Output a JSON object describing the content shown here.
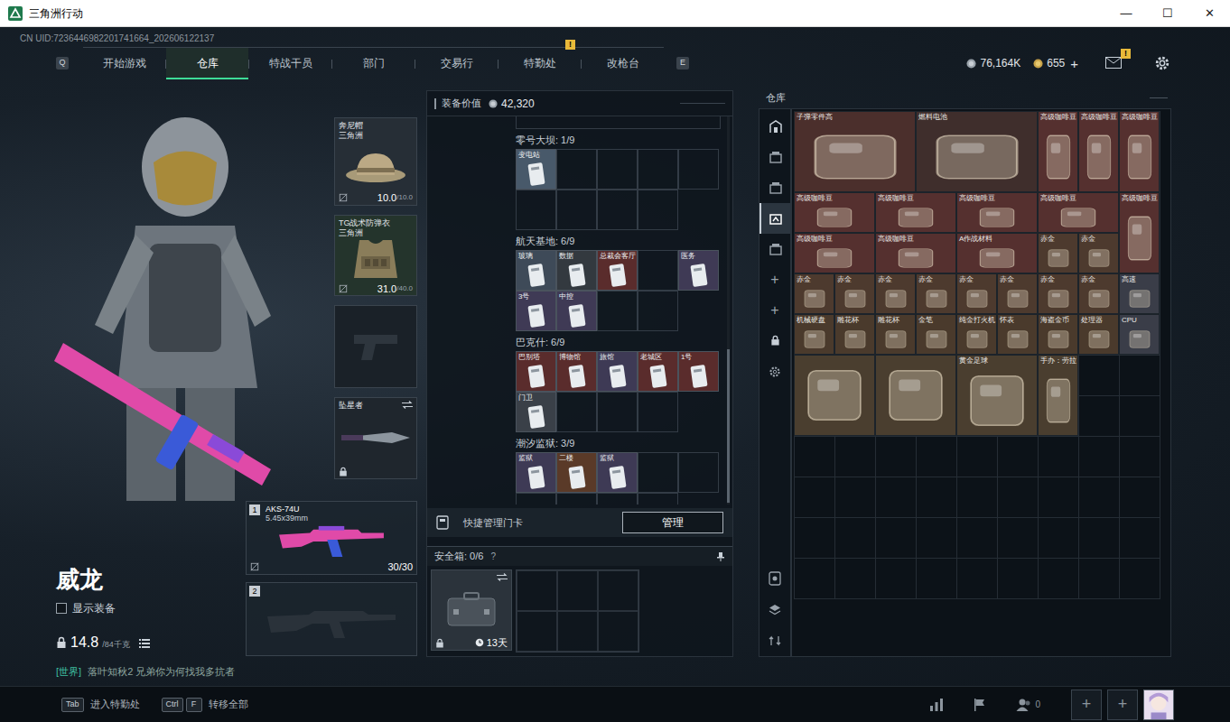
{
  "window": {
    "title": "三角洲行动",
    "controls": [
      "—",
      "☐",
      "✕"
    ]
  },
  "uid": "CN UID:7236446982201741664_202606122137",
  "nav": {
    "prev_key": "Q",
    "next_key": "E",
    "tabs": [
      {
        "label": "开始游戏",
        "selected": false
      },
      {
        "label": "仓库",
        "selected": true
      },
      {
        "label": "特战干员",
        "selected": false
      },
      {
        "label": "部门",
        "selected": false
      },
      {
        "label": "交易行",
        "selected": false
      },
      {
        "label": "特勤处",
        "selected": false,
        "badge": "!"
      },
      {
        "label": "改枪台",
        "selected": false
      }
    ]
  },
  "currency": {
    "coins": "76,164K",
    "tickets": "655",
    "add": "+",
    "mail_badge": "!"
  },
  "character": {
    "name": "威龙",
    "show_gear": {
      "label": "显示装备",
      "checked": false
    },
    "weight": "14.8",
    "weight_max": "/84千克",
    "chat_channel": "[世界]",
    "chat_message": "落叶知秋2 兄弟你为何找我多抗者"
  },
  "gear": [
    {
      "kind": "helmet",
      "name": "奔尼帽",
      "sub": "三角洲",
      "durability": "10.0",
      "max": "/10.0",
      "color": "#262e36"
    },
    {
      "kind": "armor",
      "name": "TG战术防弹衣",
      "sub": "三角洲",
      "durability": "31.0",
      "max": "/40.0",
      "color": "#24342c"
    },
    {
      "kind": "pistol",
      "color": "#1a2128"
    },
    {
      "kind": "melee",
      "name": "坠星者",
      "color": "#1f262d"
    }
  ],
  "weapons": [
    {
      "slot": "1",
      "kind": "rifle",
      "name": "AKS-74U",
      "caliber": "5.45x39mm",
      "ammo": "30/30"
    },
    {
      "slot": "2",
      "kind": "empty"
    }
  ],
  "loadout": {
    "value_label": "装备价值",
    "value": "42,320",
    "sections": [
      {
        "title": "零号大坝: 1/9",
        "slots": [
          {
            "kind": "card",
            "label": "变电站",
            "color": "#48596a"
          },
          {
            "kind": "empty"
          },
          {
            "kind": "empty"
          },
          {
            "kind": "empty"
          },
          {
            "kind": "empty"
          },
          {
            "kind": "empty"
          },
          {
            "kind": "empty"
          },
          {
            "kind": "empty"
          },
          {
            "kind": "empty"
          }
        ]
      },
      {
        "title": "航天基地: 6/9",
        "slots": [
          {
            "kind": "card",
            "label": "玻璃",
            "color": "#3e4a58"
          },
          {
            "kind": "card",
            "label": "数据",
            "color": "#33393f"
          },
          {
            "kind": "card",
            "label": "总裁会客厅",
            "color": "#5a2c2c"
          },
          {
            "kind": "empty"
          },
          {
            "kind": "card",
            "label": "医务",
            "color": "#3f3a55"
          },
          {
            "kind": "card",
            "label": "3号",
            "color": "#3f3a55"
          },
          {
            "kind": "card",
            "label": "中控",
            "color": "#3f3a55"
          },
          {
            "kind": "empty"
          },
          {
            "kind": "empty"
          }
        ]
      },
      {
        "title": "巴克什: 6/9",
        "slots": [
          {
            "kind": "card",
            "label": "巴别塔",
            "color": "#5a2c2c"
          },
          {
            "kind": "card",
            "label": "博物馆",
            "color": "#5a2c2c"
          },
          {
            "kind": "card",
            "label": "旅馆",
            "color": "#3e3a55"
          },
          {
            "kind": "card",
            "label": "老城区",
            "color": "#5a2c2c"
          },
          {
            "kind": "card",
            "label": "1号",
            "color": "#5a2c2c"
          },
          {
            "kind": "card",
            "label": "门卫",
            "color": "#3a4048"
          },
          {
            "kind": "empty"
          },
          {
            "kind": "empty"
          },
          {
            "kind": "empty"
          }
        ]
      },
      {
        "title": "潮汐监狱: 3/9",
        "slots": [
          {
            "kind": "card",
            "label": "监狱",
            "color": "#3e3a55"
          },
          {
            "kind": "card",
            "label": "二楼",
            "color": "#5a3a28"
          },
          {
            "kind": "card",
            "label": "监狱",
            "color": "#3e3a55"
          },
          {
            "kind": "empty"
          },
          {
            "kind": "empty"
          },
          {
            "kind": "empty"
          },
          {
            "kind": "empty"
          },
          {
            "kind": "empty"
          },
          {
            "kind": "empty"
          }
        ]
      }
    ],
    "quick_manage": {
      "label": "快捷管理门卡",
      "button": "管理"
    },
    "safe_box": {
      "title": "安全箱: 0/6",
      "help": "?",
      "duration": "13天"
    }
  },
  "warehouse": {
    "title": "仓库",
    "tabs": [
      {
        "selected": false
      },
      {
        "selected": false
      },
      {
        "selected": false
      },
      {
        "selected": true
      },
      {
        "selected": false
      }
    ],
    "actions": [
      "+",
      "+"
    ],
    "items": [
      {
        "kind": "block",
        "label": "子弹零件高",
        "color": "#4b2f2c"
      },
      {
        "kind": "block",
        "label": "燃料电池",
        "color": "#3f2e2c"
      },
      {
        "kind": "tall",
        "label": "高级咖啡豆",
        "color": "#55302f"
      },
      {
        "kind": "tall",
        "label": "高级咖啡豆",
        "color": "#55302f"
      },
      {
        "kind": "tall",
        "label": "高级咖啡豆",
        "color": "#55302f"
      },
      {
        "kind": "wide",
        "label": "高级咖啡豆",
        "color": "#55302f"
      },
      {
        "kind": "wide",
        "label": "高级咖啡豆",
        "color": "#55302f"
      },
      {
        "kind": "wide",
        "label": "高级咖啡豆",
        "color": "#55302f"
      },
      {
        "kind": "wide",
        "label": "高级咖啡豆",
        "color": "#55302f"
      },
      {
        "kind": "tall",
        "label": "高级咖啡豆",
        "color": "#55302f"
      },
      {
        "kind": "wide",
        "label": "高级咖啡豆",
        "color": "#55302f"
      },
      {
        "kind": "wide",
        "label": "高级咖啡豆",
        "color": "#55302f"
      },
      {
        "kind": "wide",
        "label": "A作战材料",
        "color": "#55302f"
      },
      {
        "kind": "small",
        "label": "赤金",
        "color": "#4d3a2e"
      },
      {
        "kind": "small",
        "label": "赤金",
        "color": "#4d3a2e"
      },
      {
        "kind": "small",
        "label": "赤金",
        "color": "#4d3a2e"
      },
      {
        "kind": "small",
        "label": "赤金",
        "color": "#4d3a2e"
      },
      {
        "kind": "small",
        "label": "赤金",
        "color": "#4d3a2e"
      },
      {
        "kind": "small",
        "label": "赤金",
        "color": "#4d3a2e"
      },
      {
        "kind": "small",
        "label": "赤金",
        "color": "#4d3a2e"
      },
      {
        "kind": "small",
        "label": "赤金",
        "color": "#4d3a2e"
      },
      {
        "kind": "small",
        "label": "赤金",
        "color": "#4d3a2e"
      },
      {
        "kind": "small",
        "label": "赤金",
        "color": "#4d3a2e"
      },
      {
        "kind": "small",
        "label": "高速",
        "color": "#3a3d48"
      },
      {
        "kind": "small",
        "label": "机械硬盘",
        "color": "#4a3a2c"
      },
      {
        "kind": "small",
        "label": "雕花杯",
        "color": "#4a3a2c"
      },
      {
        "kind": "small",
        "label": "雕花杯",
        "color": "#4a3a2c"
      },
      {
        "kind": "small",
        "label": "金笔",
        "color": "#4a3a2c"
      },
      {
        "kind": "small",
        "label": "纯金打火机",
        "color": "#4a3a2c"
      },
      {
        "kind": "small",
        "label": "怀表",
        "color": "#4a3a2c"
      },
      {
        "kind": "small",
        "label": "海盗金币",
        "color": "#4a3a2c"
      },
      {
        "kind": "small",
        "label": "处理器",
        "color": "#4a3a2c"
      },
      {
        "kind": "small",
        "label": "CPU",
        "color": "#3a3d48"
      },
      {
        "kind": "large",
        "color": "#4a3e2f"
      },
      {
        "kind": "large",
        "color": "#4a3e2f"
      },
      {
        "kind": "large",
        "label": "黄金足球",
        "color": "#4a3e2f"
      },
      {
        "kind": "tall",
        "label": "手办：劳拉",
        "color": "#4a3e2f"
      }
    ]
  },
  "bottom_bar": {
    "hints": [
      {
        "keys": [
          "Tab"
        ],
        "label": "进入特勤处"
      },
      {
        "keys": [
          "Ctrl",
          "F"
        ],
        "label": "转移全部"
      }
    ],
    "friends_count": "0",
    "add_buttons": [
      "+",
      "+"
    ]
  }
}
